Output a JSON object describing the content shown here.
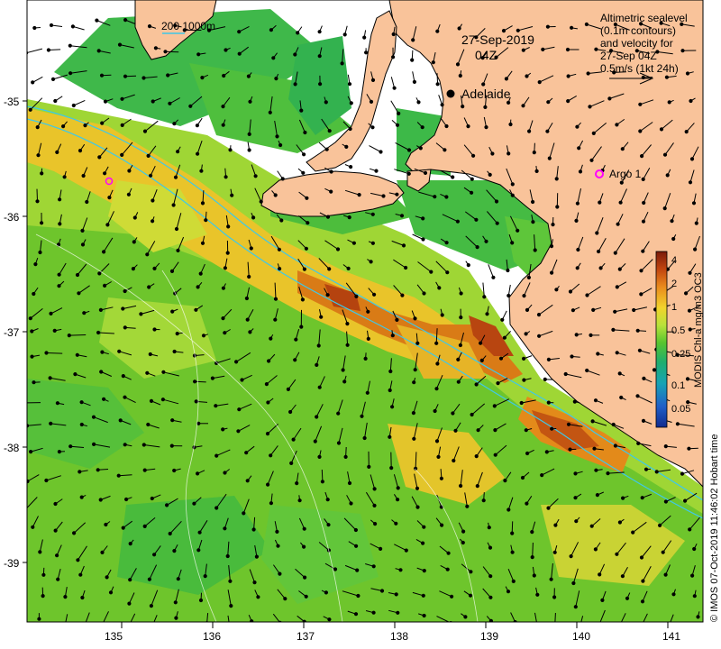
{
  "map": {
    "date": "27-Sep-2019",
    "time": "04Z",
    "legend_lines": [
      "Altimetric sealevel",
      "(0.1m contours)",
      "and velocity for",
      "27-Sep 04Z",
      "0.5m/s (1kt 24h)"
    ],
    "isobath_label": "200  1000m",
    "places": [
      {
        "name": "Adelaide"
      },
      {
        "name": "Argo 1"
      }
    ],
    "x_ticks": [
      "135",
      "136",
      "137",
      "138",
      "139",
      "140",
      "141"
    ],
    "y_ticks": [
      "-35",
      "-36",
      "-37",
      "-38",
      "-39"
    ],
    "colorbar": {
      "label": "MODIS Chl-a mg/m3 OC3",
      "ticks": [
        "4",
        "2",
        "1",
        "0.5",
        "0.25",
        "0.1",
        "0.05"
      ],
      "colors": [
        "#7a1a0a",
        "#c1440e",
        "#e98a1c",
        "#f2d32c",
        "#b8e23a",
        "#57c52f",
        "#1fae6e",
        "#18a3b5",
        "#1f5fc8",
        "#102a8e"
      ]
    },
    "credit": "© IMOS 07-Oct-2019 11:46:02 Hobart time",
    "colors": {
      "land": "#f9c39a",
      "coast": "#000000",
      "isobath": "#3fc8e8",
      "argo": "#ff00ff"
    }
  }
}
